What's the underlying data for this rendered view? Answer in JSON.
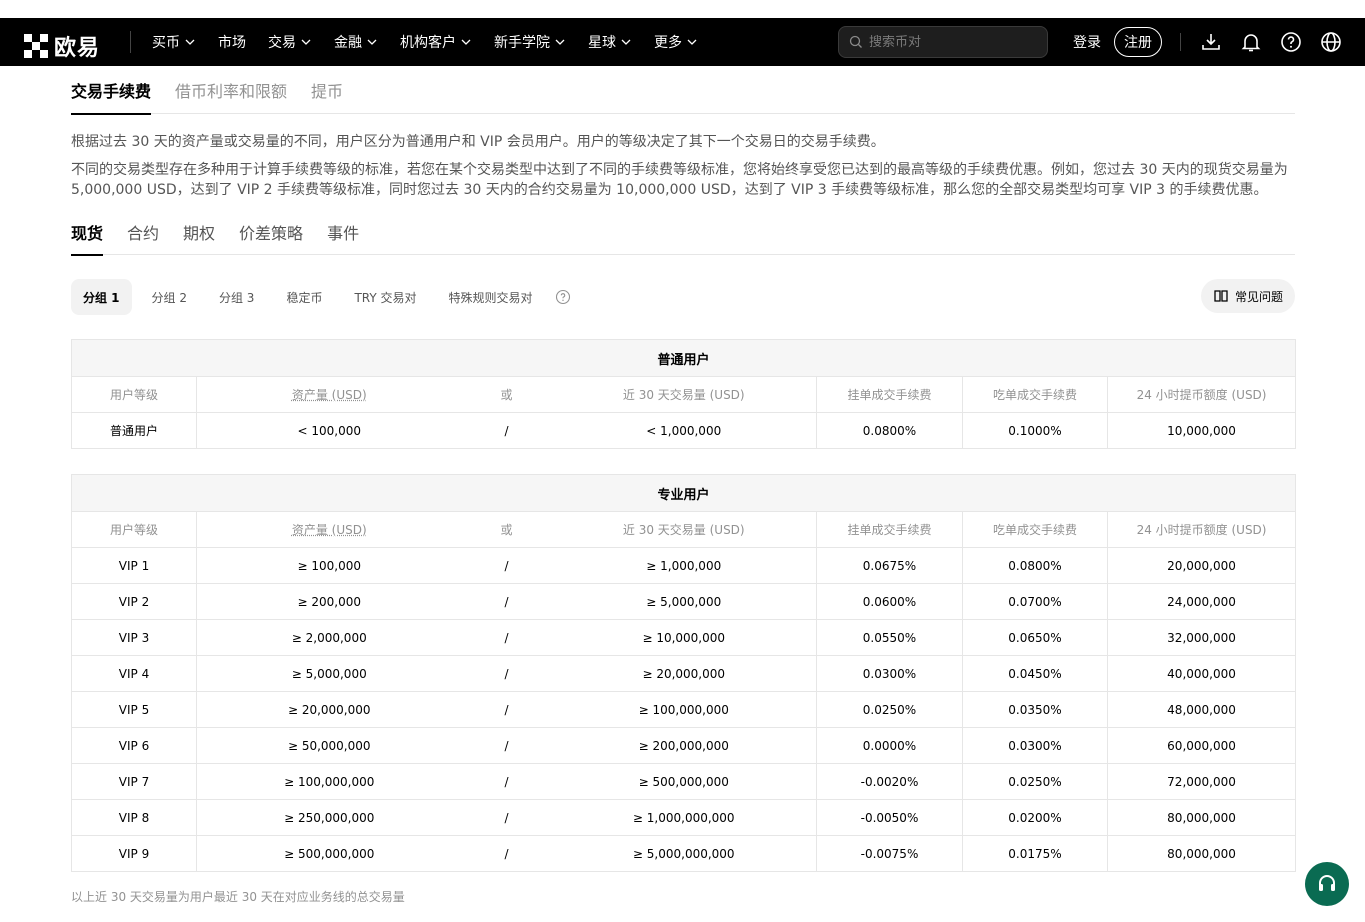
{
  "header": {
    "logo_text": "欧易",
    "nav": [
      "买币",
      "市场",
      "交易",
      "金融",
      "机构客户",
      "新手学院",
      "星球",
      "更多"
    ],
    "search_placeholder": "搜索币对",
    "login": "登录",
    "register": "注册",
    "icons": [
      "download-icon",
      "bell-icon",
      "help-icon",
      "globe-icon"
    ]
  },
  "tabs_top": [
    "交易手续费",
    "借币利率和限额",
    "提币"
  ],
  "description": {
    "line1": "根据过去 30 天的资产量或交易量的不同，用户区分为普通用户和 VIP 会员用户。用户的等级决定了其下一个交易日的交易手续费。",
    "line2": "不同的交易类型存在多种用于计算手续费等级的标准，若您在某个交易类型中达到了不同的手续费等级标准，您将始终享受您已达到的最高等级的手续费优惠。例如，您过去 30 天内的现货交易量为 5,000,000 USD，达到了 VIP 2 手续费等级标准，同时您过去 30 天内的合约交易量为 10,000,000 USD，达到了 VIP 3 手续费等级标准，那么您的全部交易类型均可享 VIP 3 的手续费优惠。"
  },
  "tabs_product": [
    "现货",
    "合约",
    "期权",
    "价差策略",
    "事件"
  ],
  "groups": [
    "分组 1",
    "分组 2",
    "分组 3",
    "稳定币",
    "TRY 交易对",
    "特殊规则交易对"
  ],
  "faq_button": "常见问题",
  "table_headers": [
    "用户等级",
    "资产量 (USD)",
    "或",
    "近 30 天交易量 (USD)",
    "挂单成交手续费",
    "吃单成交手续费",
    "24 小时提币额度 (USD)"
  ],
  "regular": {
    "caption": "普通用户",
    "rows": [
      [
        "普通用户",
        "< 100,000",
        "/",
        "< 1,000,000",
        "0.0800%",
        "0.1000%",
        "10,000,000"
      ]
    ]
  },
  "vip": {
    "caption": "专业用户",
    "rows": [
      [
        "VIP 1",
        "≥ 100,000",
        "/",
        "≥ 1,000,000",
        "0.0675%",
        "0.0800%",
        "20,000,000"
      ],
      [
        "VIP 2",
        "≥ 200,000",
        "/",
        "≥ 5,000,000",
        "0.0600%",
        "0.0700%",
        "24,000,000"
      ],
      [
        "VIP 3",
        "≥ 2,000,000",
        "/",
        "≥ 10,000,000",
        "0.0550%",
        "0.0650%",
        "32,000,000"
      ],
      [
        "VIP 4",
        "≥ 5,000,000",
        "/",
        "≥ 20,000,000",
        "0.0300%",
        "0.0450%",
        "40,000,000"
      ],
      [
        "VIP 5",
        "≥ 20,000,000",
        "/",
        "≥ 100,000,000",
        "0.0250%",
        "0.0350%",
        "48,000,000"
      ],
      [
        "VIP 6",
        "≥ 50,000,000",
        "/",
        "≥ 200,000,000",
        "0.0000%",
        "0.0300%",
        "60,000,000"
      ],
      [
        "VIP 7",
        "≥ 100,000,000",
        "/",
        "≥ 500,000,000",
        "-0.0020%",
        "0.0250%",
        "72,000,000"
      ],
      [
        "VIP 8",
        "≥ 250,000,000",
        "/",
        "≥ 1,000,000,000",
        "-0.0050%",
        "0.0200%",
        "80,000,000"
      ],
      [
        "VIP 9",
        "≥ 500,000,000",
        "/",
        "≥ 5,000,000,000",
        "-0.0075%",
        "0.0175%",
        "80,000,000"
      ]
    ]
  },
  "footnote": "以上近 30 天交易量为用户最近 30 天在对应业务线的总交易量"
}
